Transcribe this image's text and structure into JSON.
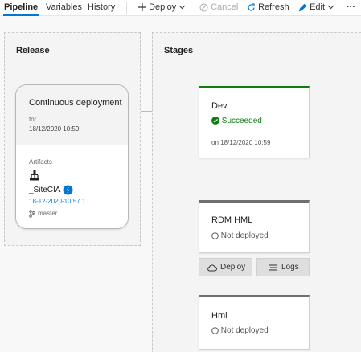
{
  "toolbar": {
    "tabs": [
      "Pipeline",
      "Variables",
      "History"
    ],
    "deploy_label": "Deploy",
    "cancel_label": "Cancel",
    "refresh_label": "Refresh",
    "edit_label": "Edit",
    "more_label": "···"
  },
  "release": {
    "title": "Release",
    "trigger": "Continuous deployment",
    "for_label": "for",
    "date": "18/12/2020 10:59",
    "artifacts_label": "Artifacts",
    "artifact_name": "_SiteCIA",
    "artifact_version": "18-12-2020-10.57.1",
    "branch": "master"
  },
  "stages": {
    "title": "Stages",
    "items": [
      {
        "name": "Dev",
        "status": "Succeeded",
        "date": "on 18/12/2020 10:59"
      },
      {
        "name": "RDM HML",
        "status": "Not deployed"
      },
      {
        "name": "Hml",
        "status": "Not deployed"
      }
    ],
    "deploy_button": "Deploy",
    "logs_button": "Logs"
  },
  "colors": {
    "accent": "#0078d4",
    "success": "#107c10",
    "pending": "#666666"
  }
}
